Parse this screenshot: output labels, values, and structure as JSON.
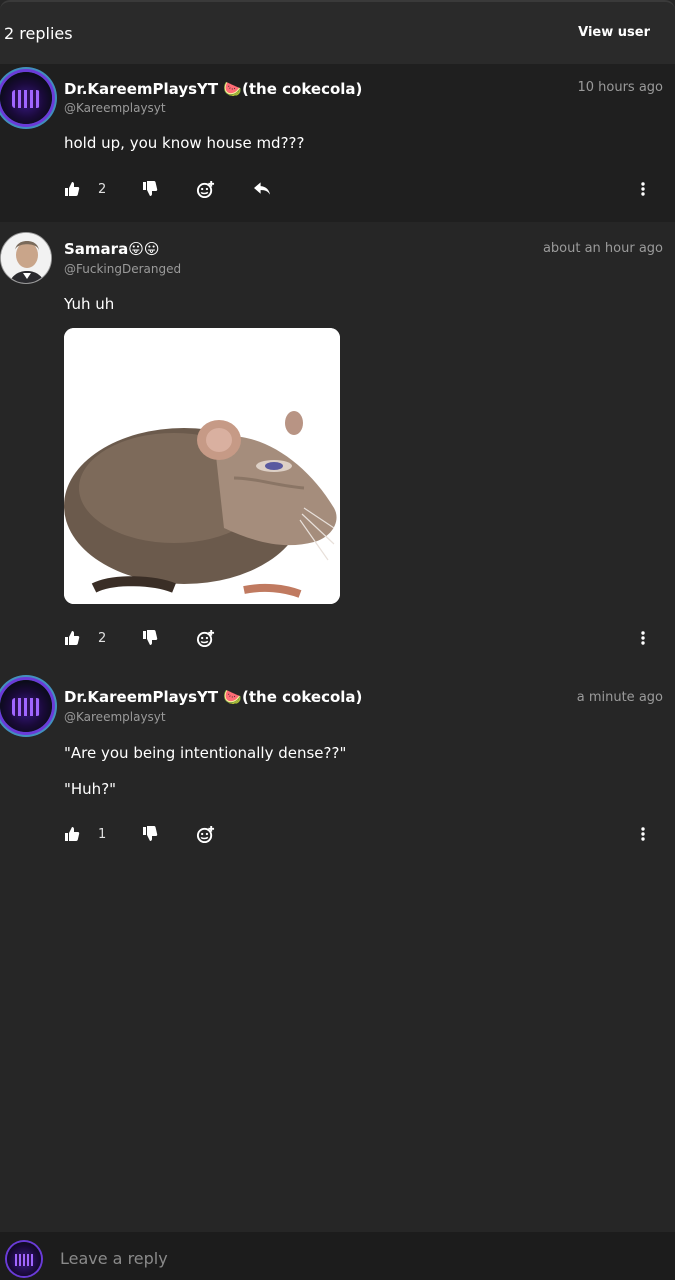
{
  "header": {
    "reply_count": "2 replies",
    "view_user_label": "View user"
  },
  "comments": [
    {
      "username": "Dr.KareemPlaysYT 🍉(the cokecola)",
      "handle": "@Kareemplaysyt",
      "time": "10 hours ago",
      "lines": [
        "hold up, you know house md???"
      ],
      "likes": "2",
      "icons": [
        "thumbs-up-icon",
        "thumbs-down-icon",
        "add-reaction-icon",
        "reply-icon",
        "more-vertical-icon"
      ]
    },
    {
      "username": "Samara😛😛",
      "handle": "@FuckingDeranged",
      "time": "about an hour ago",
      "lines": [
        "Yuh uh"
      ],
      "has_image": true,
      "likes": "2",
      "icons": [
        "thumbs-up-icon",
        "thumbs-down-icon",
        "add-reaction-icon",
        "more-vertical-icon"
      ]
    },
    {
      "username": "Dr.KareemPlaysYT 🍉(the cokecola)",
      "handle": "@Kareemplaysyt",
      "time": "a minute ago",
      "lines": [
        "\"Are you being intentionally dense??\"",
        "\"Huh?\""
      ],
      "likes": "1",
      "icons": [
        "thumbs-up-icon",
        "thumbs-down-icon",
        "add-reaction-icon",
        "more-vertical-icon"
      ]
    }
  ],
  "reply_input": {
    "placeholder": "Leave a reply",
    "value": ""
  },
  "colors": {
    "background": "#262626",
    "parent_background": "#1f1f1f",
    "muted_text": "#9a9a9a",
    "accent_ring": "#6a3bd8"
  }
}
